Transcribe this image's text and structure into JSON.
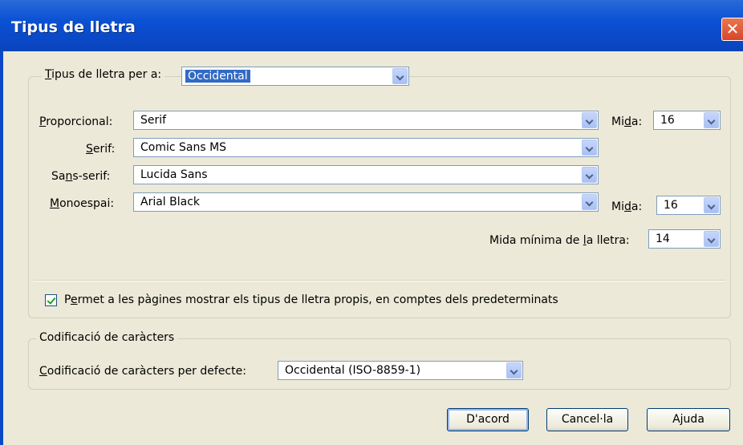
{
  "window": {
    "title": "Tipus de lletra",
    "close_glyph": "✕"
  },
  "fonts_for": {
    "label_pre": "",
    "label_ul": "T",
    "label_post": "ipus de lletra per a:",
    "value": "Occidental"
  },
  "proportional": {
    "label_ul": "P",
    "label_post": "roporcional:",
    "value": "Serif"
  },
  "serif": {
    "label_ul": "S",
    "label_post": "erif:",
    "value": "Comic Sans MS"
  },
  "sans_serif": {
    "label_pre": "Sa",
    "label_ul": "n",
    "label_post": "s-serif:",
    "value": "Lucida Sans"
  },
  "monospace": {
    "label_ul": "M",
    "label_post": "onoespai:",
    "value": "Arial Black"
  },
  "size1": {
    "label_pre": "Mi",
    "label_ul": "d",
    "label_post": "a:",
    "value": "16"
  },
  "size2": {
    "label_pre": "Mi",
    "label_ul": "d",
    "label_post": "a:",
    "value": "16"
  },
  "min_size": {
    "label_pre": "Mida mínima de ",
    "label_ul": "l",
    "label_post": "a lletra:",
    "value": "14"
  },
  "allow_pages": {
    "label_pre": "P",
    "label_ul": "e",
    "label_post": "rmet a les pàgines mostrar els tipus de lletra propis, en comptes dels predeterminats",
    "checked": true
  },
  "encoding": {
    "legend": "Codificació de caràcters",
    "label_ul": "C",
    "label_post": "odificació de caràcters per defecte:",
    "value": "Occidental (ISO-8859-1)"
  },
  "buttons": {
    "ok": "D'acord",
    "cancel": "Cancel·la",
    "help": "Ajuda"
  }
}
